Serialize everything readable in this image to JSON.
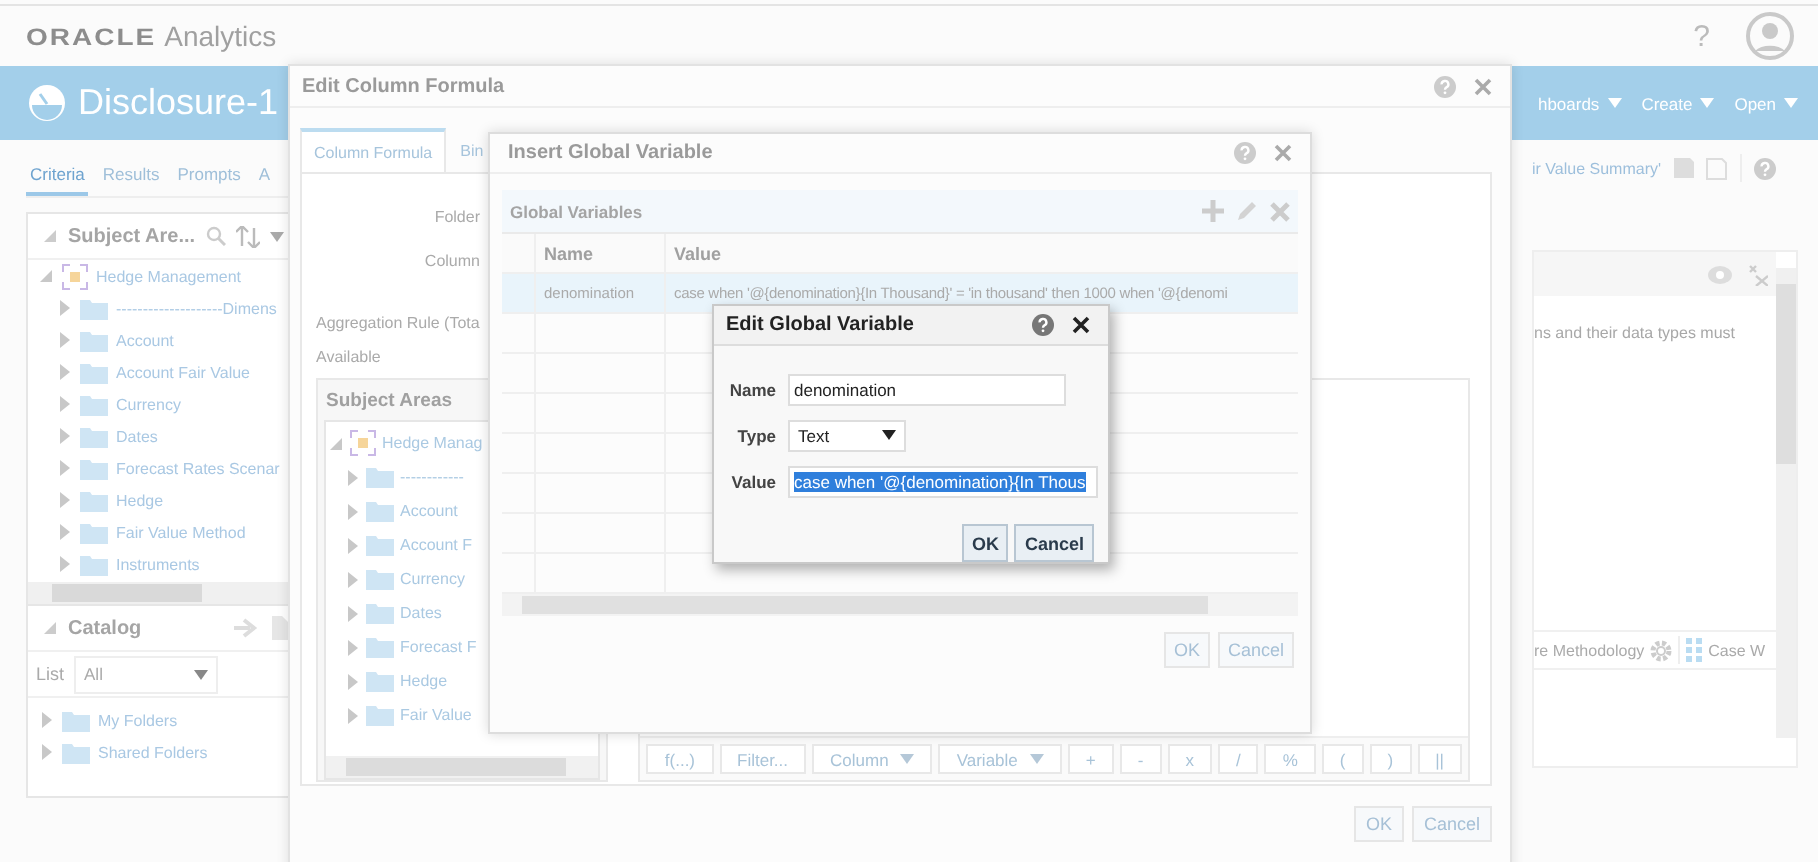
{
  "header": {
    "brand": "ORACLE",
    "product": "Analytics",
    "help": "?"
  },
  "banner": {
    "title": "Disclosure-1",
    "menus": [
      {
        "label": "hboards"
      },
      {
        "label": "Create"
      },
      {
        "label": "Open"
      }
    ]
  },
  "tabs": [
    {
      "label": "Criteria",
      "selected": true
    },
    {
      "label": "Results",
      "selected": false
    },
    {
      "label": "Prompts",
      "selected": false
    },
    {
      "label": "A",
      "selected": false
    }
  ],
  "subject_areas_panel": {
    "title": "Subject Are...",
    "tree": [
      {
        "label": "Hedge Management",
        "expanded": true,
        "children": [
          {
            "label": "--------------------Dimens",
            "expanded": false
          },
          {
            "label": "Account",
            "expanded": false
          },
          {
            "label": "Account Fair Value",
            "expanded": false
          },
          {
            "label": "Currency",
            "expanded": false
          },
          {
            "label": "Dates",
            "expanded": false
          },
          {
            "label": "Forecast Rates Scenar",
            "expanded": false
          },
          {
            "label": "Hedge",
            "expanded": false
          },
          {
            "label": "Fair Value Method",
            "expanded": false
          },
          {
            "label": "Instruments",
            "expanded": false
          }
        ]
      }
    ]
  },
  "catalog": {
    "title": "Catalog",
    "list_label": "List",
    "list_value": "All",
    "folders": [
      {
        "label": "My Folders",
        "expanded": false
      },
      {
        "label": "Shared Folders",
        "expanded": false
      }
    ]
  },
  "right_panel": {
    "link": "ir Value Summary'",
    "note": "ns and their data types must",
    "toolbar": [
      "re Methodology",
      "Case W"
    ]
  },
  "formula_dialog": {
    "title": "Edit Column Formula",
    "tabs": [
      {
        "label": "Column Formula",
        "selected": true
      },
      {
        "label": "Bin",
        "selected": false
      }
    ],
    "folder_label": "Folder",
    "column_label": "Column",
    "aggregation_label": "Aggregation Rule (Tota",
    "available_label": "Available",
    "subject_areas": {
      "title": "Subject Areas",
      "tree": [
        {
          "label": "Hedge Manag",
          "expanded": true,
          "children": [
            {
              "label": "------------",
              "expanded": false
            },
            {
              "label": "Account",
              "expanded": false
            },
            {
              "label": "Account F",
              "expanded": false
            },
            {
              "label": "Currency",
              "expanded": false
            },
            {
              "label": "Dates",
              "expanded": false
            },
            {
              "label": "Forecast F",
              "expanded": false
            },
            {
              "label": "Hedge",
              "expanded": false
            },
            {
              "label": "Fair Value",
              "expanded": false
            }
          ]
        }
      ]
    },
    "operators": [
      {
        "label": "f(...)",
        "kind": "plain"
      },
      {
        "label": "Filter...",
        "kind": "plain"
      },
      {
        "label": "Column",
        "kind": "menu"
      },
      {
        "label": "Variable",
        "kind": "menu"
      },
      {
        "label": "+",
        "kind": "plain"
      },
      {
        "label": "-",
        "kind": "plain"
      },
      {
        "label": "x",
        "kind": "plain"
      },
      {
        "label": "/",
        "kind": "plain"
      },
      {
        "label": "%",
        "kind": "plain"
      },
      {
        "label": "(",
        "kind": "plain"
      },
      {
        "label": ")",
        "kind": "plain"
      },
      {
        "label": "||",
        "kind": "plain"
      }
    ],
    "buttons": [
      "OK",
      "Cancel"
    ]
  },
  "global_dialog": {
    "title": "Insert Global Variable",
    "section": "Global Variables",
    "columns": [
      "Name",
      "Value"
    ],
    "rows": [
      {
        "name": "denomination",
        "value": "case when '@{denomination}{In Thousand}' = 'in thousand' then 1000 when '@{denomi",
        "selected": true
      }
    ],
    "buttons": [
      "OK",
      "Cancel"
    ]
  },
  "edit_dialog": {
    "title": "Edit Global Variable",
    "fields": [
      {
        "label": "Name",
        "kind": "text",
        "value": "denomination"
      },
      {
        "label": "Type",
        "kind": "select",
        "value": "Text"
      },
      {
        "label": "Value",
        "kind": "text",
        "value": "case when '@{denomination}{In Thous",
        "highlighted": true
      }
    ],
    "buttons": [
      "OK",
      "Cancel"
    ]
  }
}
